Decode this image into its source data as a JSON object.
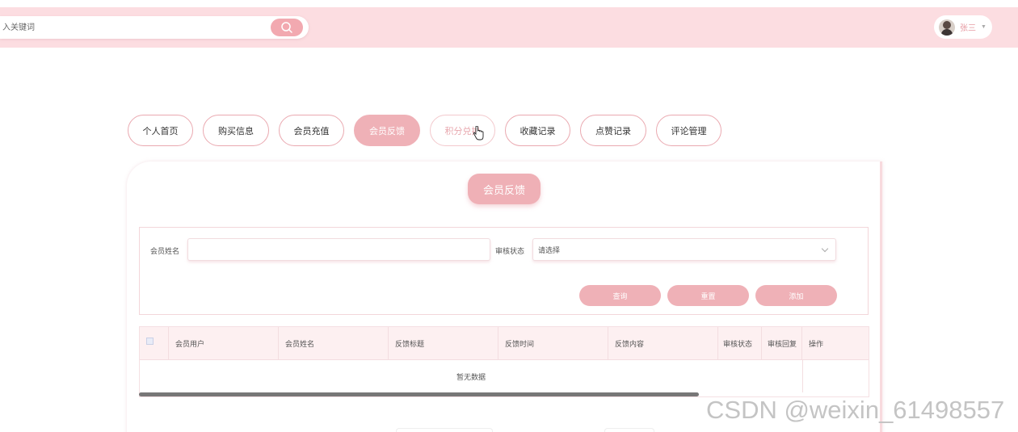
{
  "header": {
    "search_placeholder": "入关键词",
    "user_name": "张三"
  },
  "nav": {
    "tabs": [
      {
        "label": "个人首页"
      },
      {
        "label": "购买信息"
      },
      {
        "label": "会员充值"
      },
      {
        "label": "会员反馈"
      },
      {
        "label": "积分兑换"
      },
      {
        "label": "收藏记录"
      },
      {
        "label": "点赞记录"
      },
      {
        "label": "评论管理"
      }
    ],
    "active": "会员反馈"
  },
  "card": {
    "title": "会员反馈"
  },
  "filter": {
    "name_label": "会员姓名",
    "name_value": "",
    "status_label": "审核状态",
    "status_placeholder": "请选择",
    "query_label": "查询",
    "reset_label": "重置",
    "add_label": "添加"
  },
  "table": {
    "columns": [
      "会员用户",
      "会员姓名",
      "反馈标题",
      "反馈时间",
      "反馈内容",
      "审核状态",
      "审核回复",
      "操作"
    ],
    "empty_text": "暂无数据"
  },
  "watermark": "CSDN @weixin_61498557",
  "colors": {
    "accent": "#efb1b7",
    "header_bg": "#fcdde1"
  }
}
